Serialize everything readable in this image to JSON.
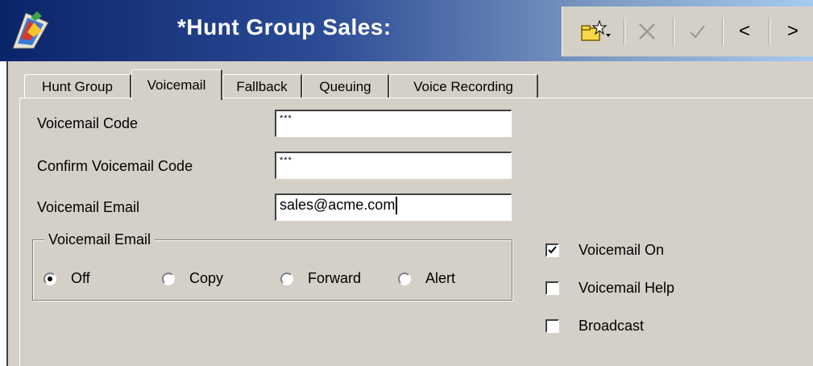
{
  "window": {
    "title": "*Hunt Group Sales:",
    "toolbar": {
      "new_icon": "new-item-icon",
      "delete_icon": "delete-icon",
      "ok_icon": "checkmark-icon",
      "prev_label": "<",
      "next_label": ">"
    }
  },
  "tabs": [
    {
      "label": "Hunt Group",
      "active": false
    },
    {
      "label": "Voicemail",
      "active": true
    },
    {
      "label": "Fallback",
      "active": false
    },
    {
      "label": "Queuing",
      "active": false
    },
    {
      "label": "Voice Recording",
      "active": false
    }
  ],
  "form": {
    "voicemail_code": {
      "label": "Voicemail Code",
      "value": "***"
    },
    "confirm_code": {
      "label": "Confirm Voicemail Code",
      "value": "***"
    },
    "voicemail_email": {
      "label": "Voicemail Email",
      "value": "sales@acme.com"
    }
  },
  "email_mode": {
    "title": "Voicemail Email",
    "options": [
      {
        "label": "Off",
        "selected": true
      },
      {
        "label": "Copy",
        "selected": false
      },
      {
        "label": "Forward",
        "selected": false
      },
      {
        "label": "Alert",
        "selected": false
      }
    ]
  },
  "checkboxes": [
    {
      "label": "Voicemail On",
      "checked": true
    },
    {
      "label": "Voicemail Help",
      "checked": false
    },
    {
      "label": "Broadcast",
      "checked": false
    }
  ],
  "colors": {
    "titlebar_start": "#0a246a",
    "titlebar_end": "#a6caf0",
    "face": "#d4d0c8"
  }
}
